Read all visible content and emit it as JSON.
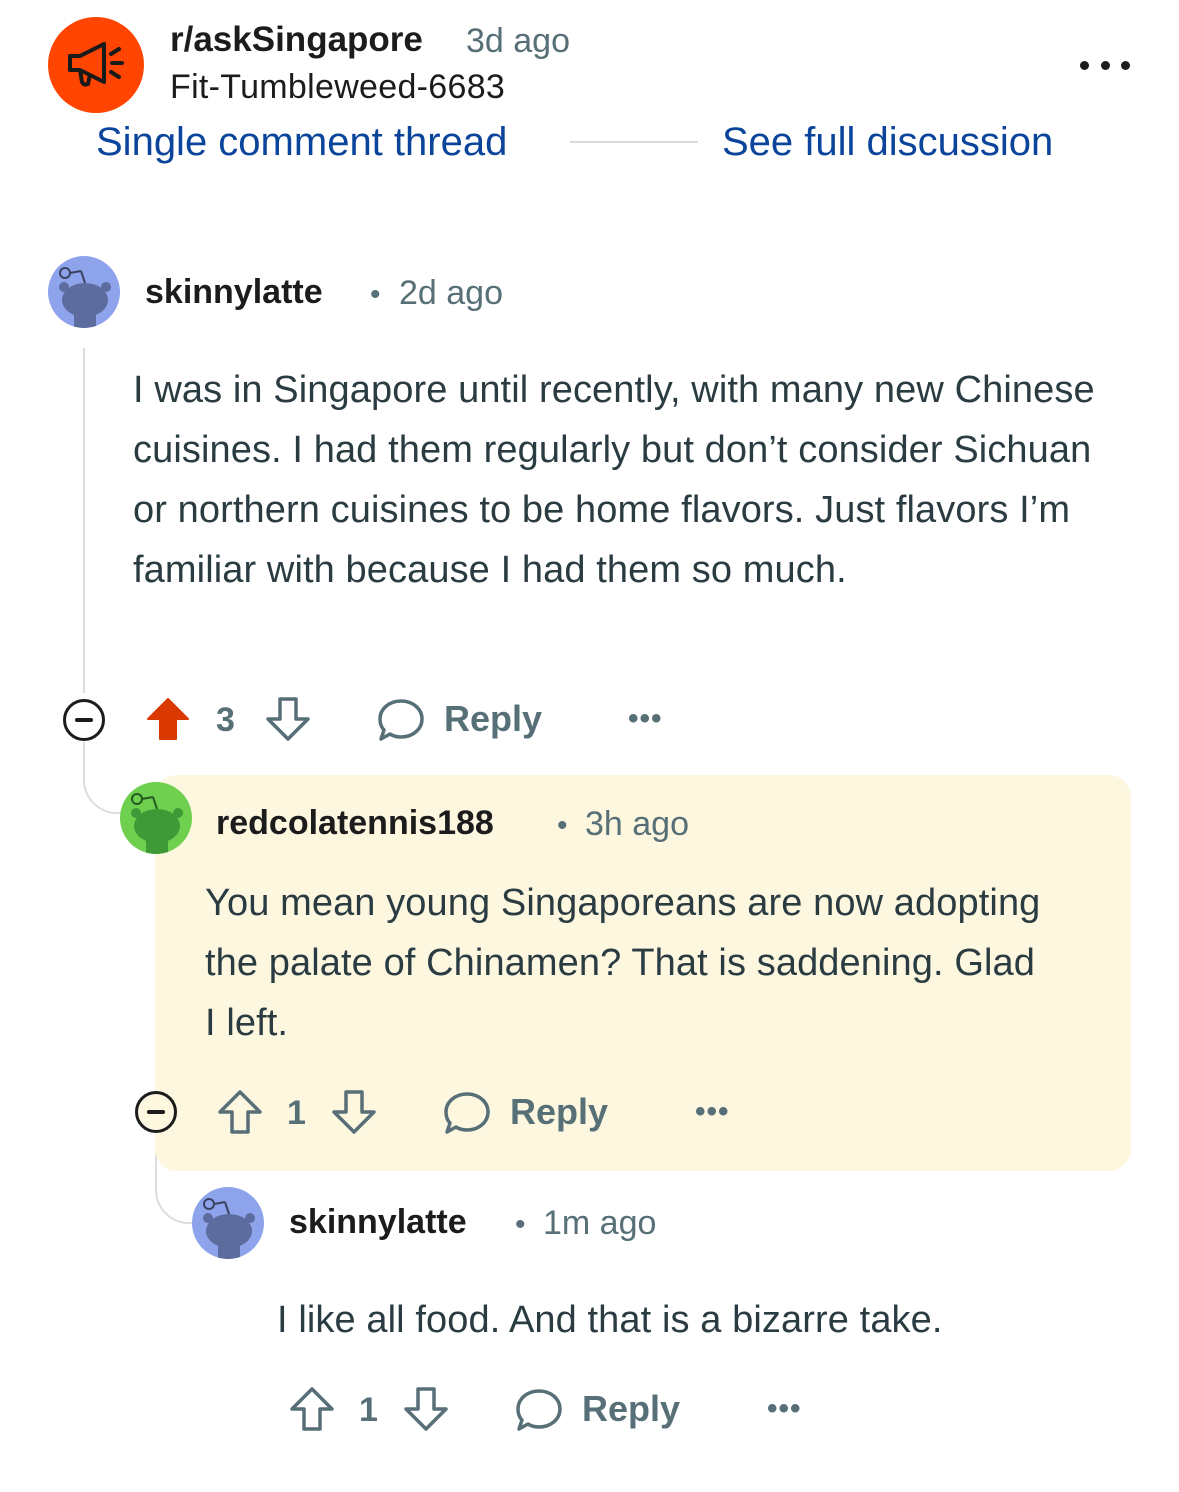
{
  "post": {
    "subreddit": "r/askSingapore",
    "time": "3d ago",
    "author": "Fit-Tumbleweed-6683",
    "single_thread_label": "Single comment thread",
    "full_discussion_label": "See full discussion"
  },
  "comments": [
    {
      "username": "skinnylatte",
      "time": "2d ago",
      "body": "I was in Singapore until recently, with many new Chinese cuisines. I had them regularly but don’t consider Sichuan or northern cuisines to be home flavors. Just flavors I’m familiar with because I had them so much.",
      "score": "3",
      "reply_label": "Reply",
      "upvoted": true
    },
    {
      "username": "redcolatennis188",
      "time": "3h ago",
      "body": "You mean young Singaporeans are now adopting the palate of Chinamen? That is saddening. Glad I left.",
      "score": "1",
      "reply_label": "Reply",
      "highlighted": true
    },
    {
      "username": "skinnylatte",
      "time": "1m ago",
      "body": "I like all food. And that is a bizarre take.",
      "score": "1",
      "reply_label": "Reply"
    }
  ],
  "colors": {
    "accent": "#ff4500",
    "link": "#0a449b",
    "highlight_bg": "#fdf7e0",
    "avatar_blue": "#8da4ec",
    "avatar_green": "#6fcf4f"
  }
}
